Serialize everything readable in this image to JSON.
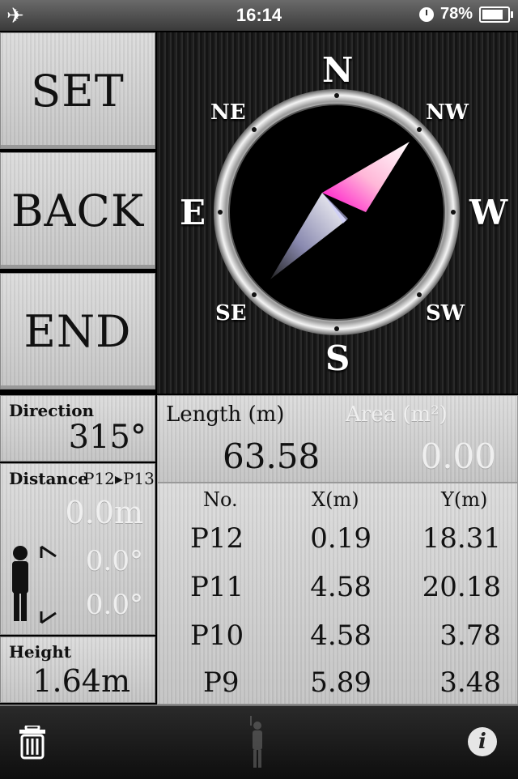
{
  "status": {
    "time": "16:14",
    "battery": "78%",
    "battery_level": 0.78,
    "airplane_icon": "airplane-icon"
  },
  "buttons": {
    "set": "SET",
    "back": "BACK",
    "end": "END"
  },
  "compass": {
    "north": "N",
    "south": "S",
    "east": "E",
    "west": "W",
    "ne": "NE",
    "nw": "NW",
    "se": "SE",
    "sw": "SW"
  },
  "direction": {
    "label": "Direction",
    "value": "315°"
  },
  "distance": {
    "label": "Distance",
    "segment": "P12▸P13",
    "value": "0.0m",
    "angle1": "0.0°",
    "angle2": "0.0°"
  },
  "height": {
    "label": "Height",
    "value": "1.64m"
  },
  "length": {
    "label": "Length (m)",
    "value": "63.58"
  },
  "area": {
    "label": "Area (m²)",
    "value": "0.00"
  },
  "table": {
    "headers": {
      "no": "No.",
      "x": "X(m)",
      "y": "Y(m)"
    },
    "rows": [
      {
        "no": "P12",
        "x": "0.19",
        "y": "18.31"
      },
      {
        "no": "P11",
        "x": "4.58",
        "y": "20.18"
      },
      {
        "no": "P10",
        "x": "4.58",
        "y": "3.78"
      },
      {
        "no": "P9",
        "x": "5.89",
        "y": "3.48"
      }
    ]
  },
  "toolbar": {
    "trash_icon": "trash-icon",
    "person_icon": "person-icon",
    "info_icon": "info-icon"
  }
}
